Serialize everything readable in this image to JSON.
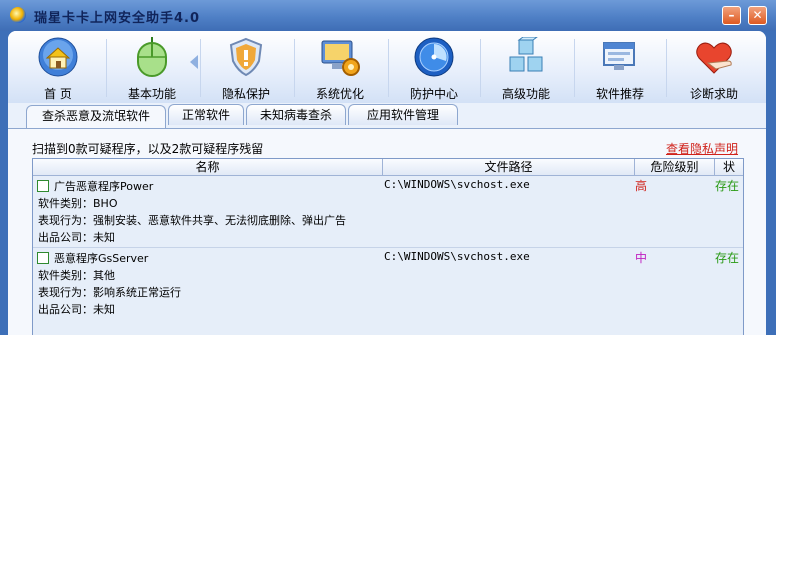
{
  "window": {
    "title": "瑞星卡卡上网安全助手4.0",
    "min_glyph": "–",
    "close_glyph": "✕"
  },
  "toolbar": {
    "items": [
      {
        "label": "首 页",
        "icon": "home-icon"
      },
      {
        "label": "基本功能",
        "icon": "mouse-icon"
      },
      {
        "label": "隐私保护",
        "icon": "shield-icon"
      },
      {
        "label": "系统优化",
        "icon": "monitor-gear-icon"
      },
      {
        "label": "防护中心",
        "icon": "radar-icon"
      },
      {
        "label": "高级功能",
        "icon": "cubes-icon"
      },
      {
        "label": "软件推荐",
        "icon": "windows-icon"
      },
      {
        "label": "诊断求助",
        "icon": "heart-hand-icon"
      }
    ]
  },
  "subtabs": [
    "查杀恶意及流氓软件",
    "正常软件",
    "未知病毒查杀",
    "应用软件管理"
  ],
  "scan": {
    "summary": "扫描到0款可疑程序，以及2款可疑程序残留",
    "privacy_link": "查看隐私声明"
  },
  "table": {
    "headers": [
      "名称",
      "文件路径",
      "危险级别",
      "状"
    ],
    "rows": [
      {
        "name": "广告恶意程序Power",
        "path": "C:\\WINDOWS\\svchost.exe",
        "level": "高",
        "level_color": "#d0221b",
        "status": "存在",
        "category": "软件类别：BHO",
        "behavior": "表现行为：强制安装、恶意软件共享、无法彻底删除、弹出广告",
        "company": "出品公司：未知"
      },
      {
        "name": "恶意程序GsServer",
        "path": "C:\\WINDOWS\\svchost.exe",
        "level": "中",
        "level_color": "#c020c0",
        "status": "存在",
        "category": "软件类别：其他",
        "behavior": "表现行为：影响系统正常运行",
        "company": "出品公司：未知"
      }
    ]
  }
}
